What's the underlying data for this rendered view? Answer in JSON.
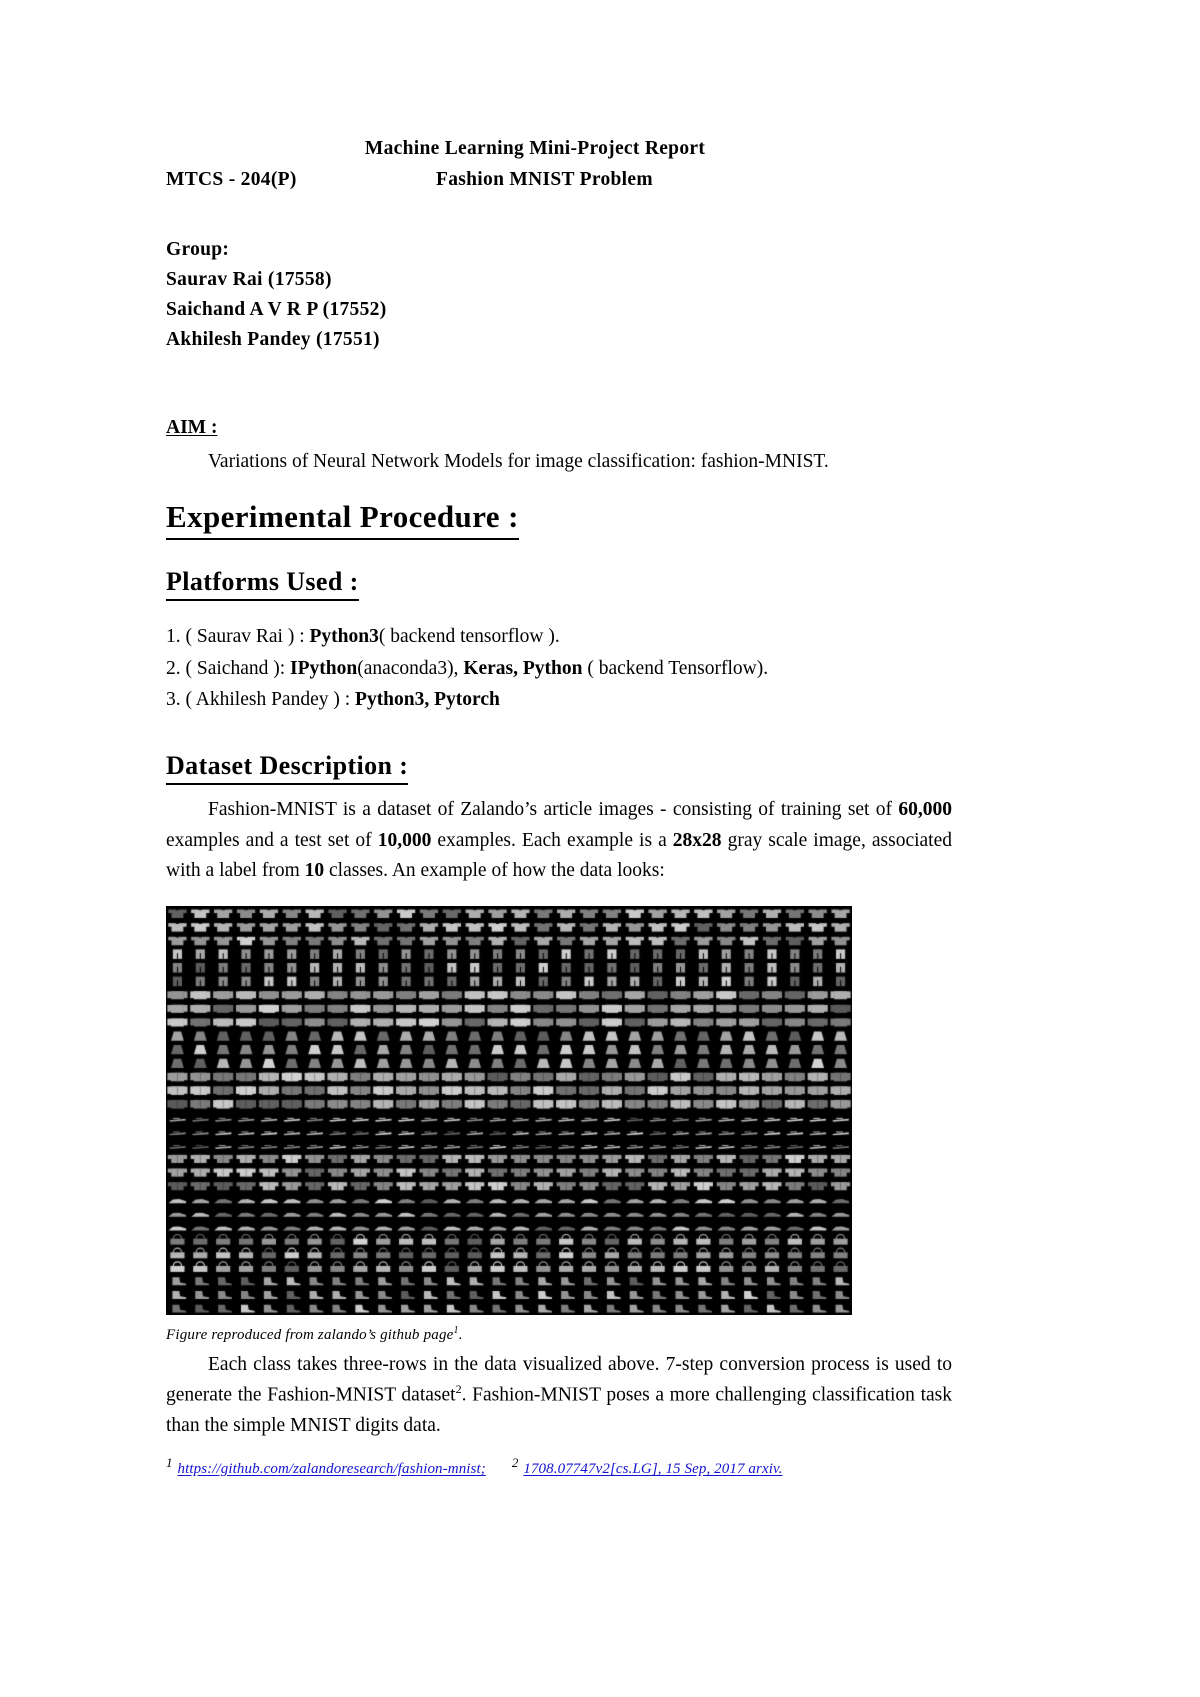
{
  "document": {
    "title_main": "Machine Learning Mini-Project Report",
    "subject_code": "MTCS - 204(P)",
    "subject_name": "Fashion MNIST Problem"
  },
  "group": {
    "label": "Group:",
    "members": [
      "Saurav Rai (17558)",
      "Saichand A V R P (17552)",
      "Akhilesh Pandey (17551)"
    ]
  },
  "aim": {
    "label": "AIM :",
    "text": "Variations of Neural Network Models for image classification: fashion-MNIST."
  },
  "sections": {
    "experimental_procedure": "Experimental Procedure :",
    "platforms_used": "Platforms Used :",
    "dataset_description": "Dataset Description :"
  },
  "platforms": [
    {
      "number": "1.",
      "person": "( Saurav Rai ) : ",
      "tool_bold": "Python3",
      "suffix": "( backend tensorflow )."
    },
    {
      "number": "2.",
      "person": "( Saichand ): ",
      "tool_bold": "IPython",
      "mid_regular": "(anaconda3), ",
      "tool_bold2": "Keras, Python",
      "suffix": " ( backend Tensorflow)."
    },
    {
      "number": "3.",
      "person": "( Akhilesh Pandey ) : ",
      "tool_bold": "Python3, Pytorch",
      "suffix": ""
    }
  ],
  "dataset": {
    "p1_a": "Fashion-MNIST is a dataset of Zalando’s article images - consisting of training set of ",
    "p1_n1": "60,000",
    "p1_b": " examples and a test set of ",
    "p1_n2": "10,000",
    "p1_c": " examples. Each example is a ",
    "p1_n3": "28x28",
    "p1_d": " gray scale image, associated with a label from ",
    "p1_n4": "10",
    "p1_e": " classes. An example of how the data looks:"
  },
  "figure": {
    "caption_text": "Figure reproduced from zalando’s github page",
    "caption_sup": "1",
    "caption_end": "."
  },
  "closing": {
    "a": "Each class takes three-rows in the data visualized above. 7-step conversion process is used to generate the Fashion-MNIST dataset",
    "sup": "2",
    "b": ". Fashion-MNIST poses a more challenging classification task than the simple MNIST digits data."
  },
  "footnotes": [
    {
      "num": "1",
      "link": "https://github.com/zalandoresearch/fashion-mnist;"
    },
    {
      "num": "2",
      "link": "1708.07747v2[cs.LG],  15  Sep,  2017  arxiv."
    }
  ],
  "colors": {
    "link": "#1414d2",
    "text": "#000000",
    "figure_background": "#000000"
  }
}
